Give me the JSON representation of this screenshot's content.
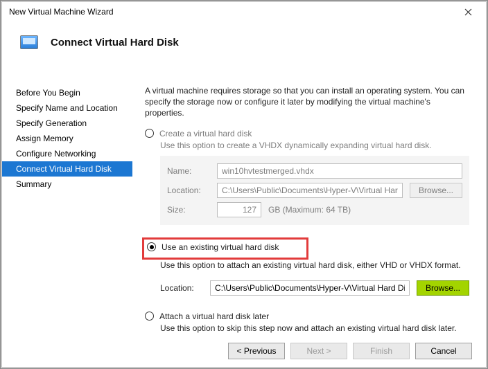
{
  "window": {
    "title": "New Virtual Machine Wizard"
  },
  "header": {
    "title": "Connect Virtual Hard Disk"
  },
  "sidebar": {
    "items": [
      {
        "label": "Before You Begin"
      },
      {
        "label": "Specify Name and Location"
      },
      {
        "label": "Specify Generation"
      },
      {
        "label": "Assign Memory"
      },
      {
        "label": "Configure Networking"
      },
      {
        "label": "Connect Virtual Hard Disk"
      },
      {
        "label": "Summary"
      }
    ],
    "active_index": 5
  },
  "content": {
    "intro": "A virtual machine requires storage so that you can install an operating system. You can specify the storage now or configure it later by modifying the virtual machine's properties.",
    "opt_create": {
      "label": "Create a virtual hard disk",
      "desc": "Use this option to create a VHDX dynamically expanding virtual hard disk.",
      "name_label": "Name:",
      "name_value": "win10hvtestmerged.vhdx",
      "location_label": "Location:",
      "location_value": "C:\\Users\\Public\\Documents\\Hyper-V\\Virtual Hard Disks\\",
      "browse_label": "Browse...",
      "size_label": "Size:",
      "size_value": "127",
      "size_suffix": "GB (Maximum: 64 TB)"
    },
    "opt_existing": {
      "label": "Use an existing virtual hard disk",
      "desc": "Use this option to attach an existing virtual hard disk, either VHD or VHDX format.",
      "location_label": "Location:",
      "location_value": "C:\\Users\\Public\\Documents\\Hyper-V\\Virtual Hard Disks\\",
      "browse_label": "Browse..."
    },
    "opt_later": {
      "label": "Attach a virtual hard disk later",
      "desc": "Use this option to skip this step now and attach an existing virtual hard disk later."
    }
  },
  "footer": {
    "previous": "< Previous",
    "next": "Next >",
    "finish": "Finish",
    "cancel": "Cancel"
  }
}
